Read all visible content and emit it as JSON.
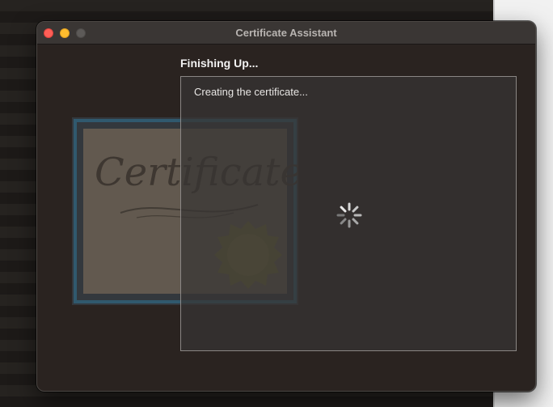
{
  "window": {
    "title": "Certificate Assistant"
  },
  "content": {
    "heading": "Finishing Up...",
    "status_text": "Creating the certificate..."
  },
  "illustration": {
    "certificate_text": "Certificate",
    "icon": "certificate-icon"
  },
  "colors": {
    "close": "#fe5f57",
    "minimize": "#febc2e",
    "zoom_inactive": "#5d5a58",
    "window_bg": "#2a2320"
  }
}
